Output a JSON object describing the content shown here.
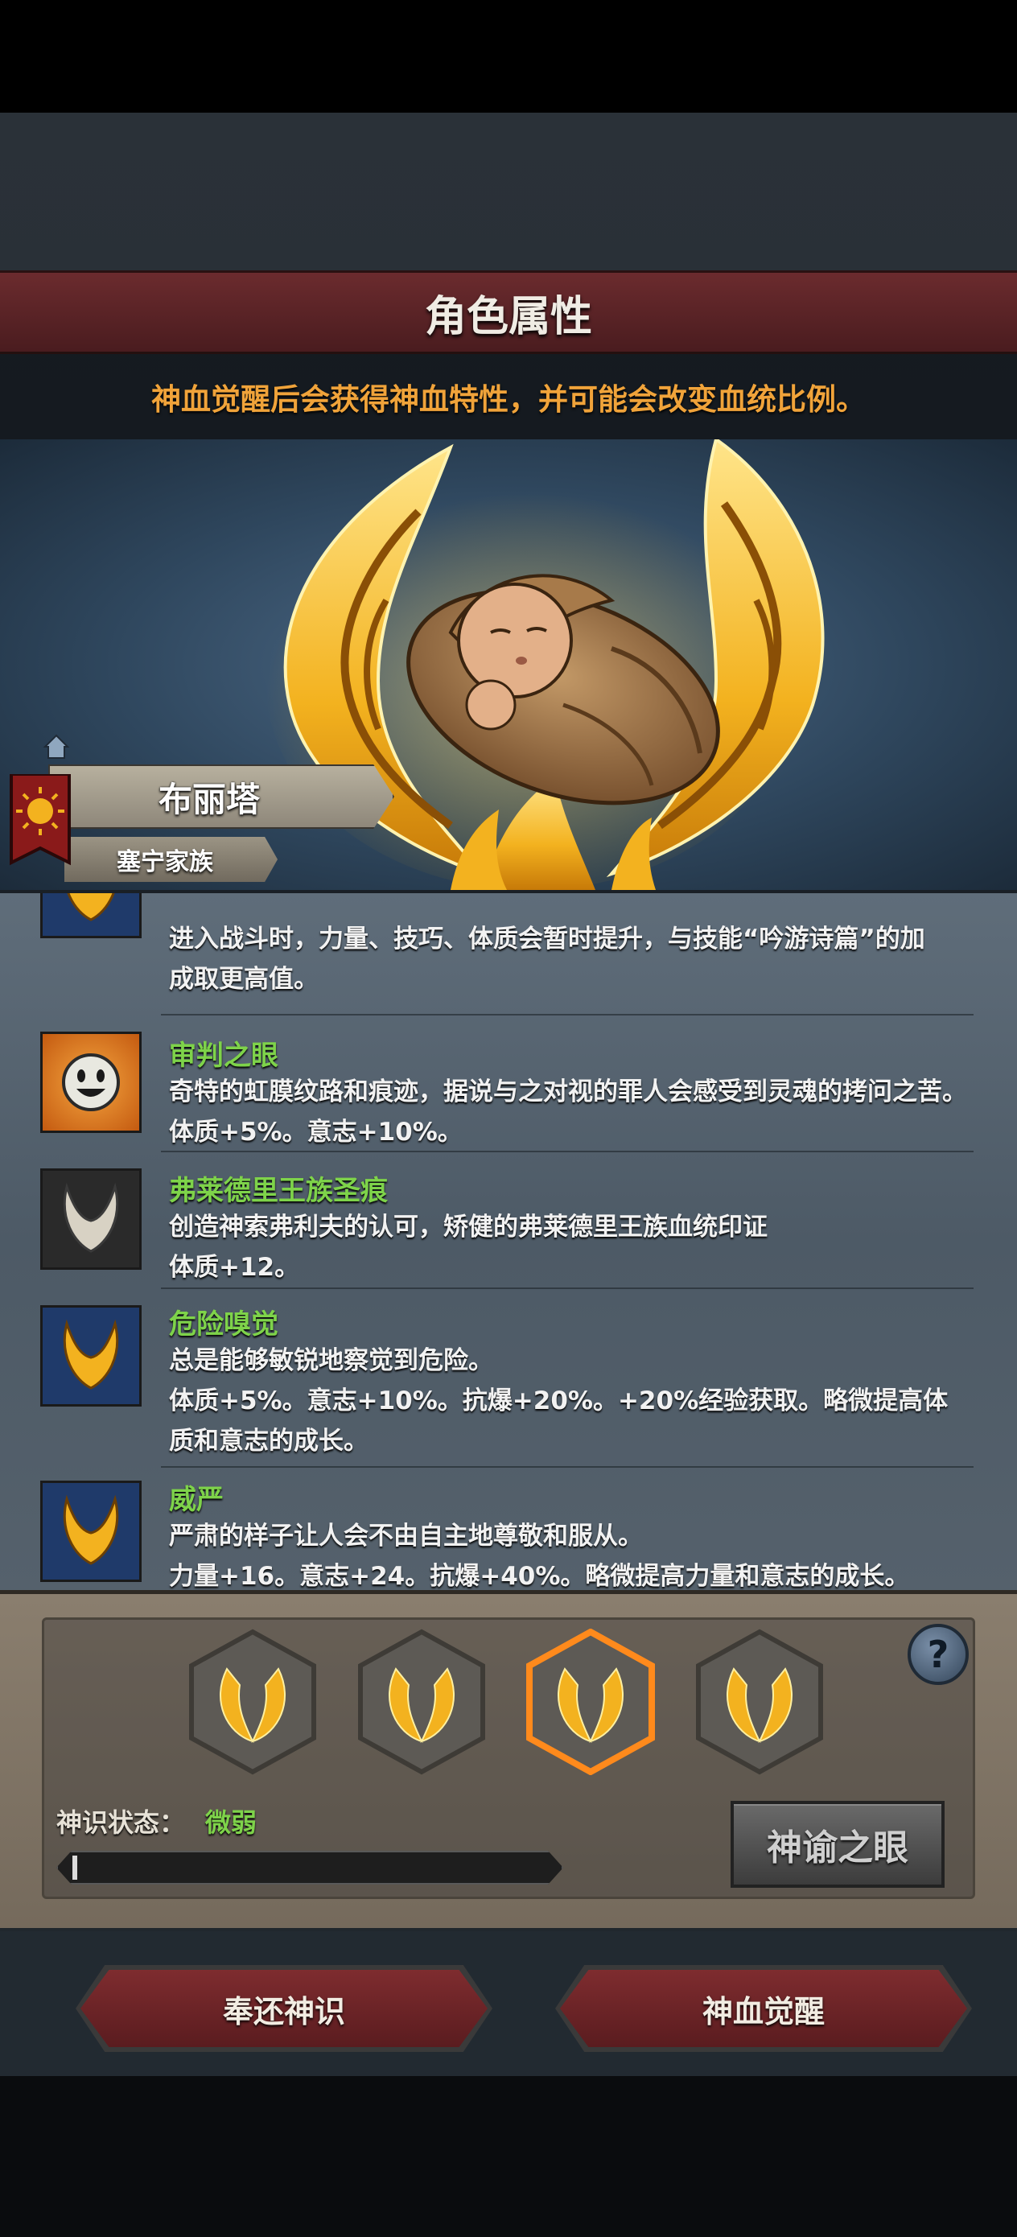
{
  "header": {
    "title": "角色属性",
    "subtitle": "神血觉醒后会获得神血特性，并可能会改变血统比例。"
  },
  "character": {
    "name": "布丽塔",
    "family": "塞宁家族",
    "portrait": "swaddled-baby-portrait",
    "frame_icon": "golden-flame-laurel-icon",
    "flag_icon": "sun-banner-icon"
  },
  "traits": [
    {
      "name": "",
      "icon": "golden-horns-icon",
      "lines": [
        "进入战斗时，力量、技巧、体质会暂时提升，与技能“吟游诗篇”的加",
        "成取更高值。"
      ]
    },
    {
      "name": "审判之眼",
      "icon": "smiling-face-icon",
      "lines": [
        "奇特的虹膜纹路和痕迹，据说与之对视的罪人会感受到灵魂的拷问之苦。",
        "体质+5%。意志+10%。"
      ]
    },
    {
      "name": "弗莱德里王族圣痕",
      "icon": "silver-horns-icon",
      "lines": [
        "创造神索弗利夫的认可，矫健的弗莱德里王族血统印证",
        "体质+12。"
      ]
    },
    {
      "name": "危险嗅觉",
      "icon": "golden-horns-icon",
      "lines": [
        "总是能够敏锐地察觉到危险。",
        "体质+5%。意志+10%。抗爆+20%。+20%经验获取。略微提高体",
        "质和意志的成长。"
      ]
    },
    {
      "name": "威严",
      "icon": "golden-horns-icon",
      "lines": [
        "严肃的样子让人会不由自主地尊敬和服从。",
        "力量+16。意志+24。抗爆+40%。略微提高力量和意志的成长。"
      ]
    }
  ],
  "awakening": {
    "slots": [
      {
        "icon": "golden-laurel-icon",
        "selected": false
      },
      {
        "icon": "golden-laurel-icon",
        "selected": false
      },
      {
        "icon": "golden-laurel-icon",
        "selected": true
      },
      {
        "icon": "golden-laurel-icon",
        "selected": false
      }
    ],
    "help_label": "?",
    "status_label": "神识状态：",
    "status_value": "微弱",
    "progress": 0.01,
    "oracle_button": "神谕之眼"
  },
  "footer": {
    "return_button": "奉还神识",
    "awaken_button": "神血觉醒"
  },
  "colors": {
    "accent_orange": "#f0a33a",
    "trait_green": "#7ed34a",
    "banner_red": "#6b2b2e",
    "selected_glow": "#ff8a1c"
  }
}
